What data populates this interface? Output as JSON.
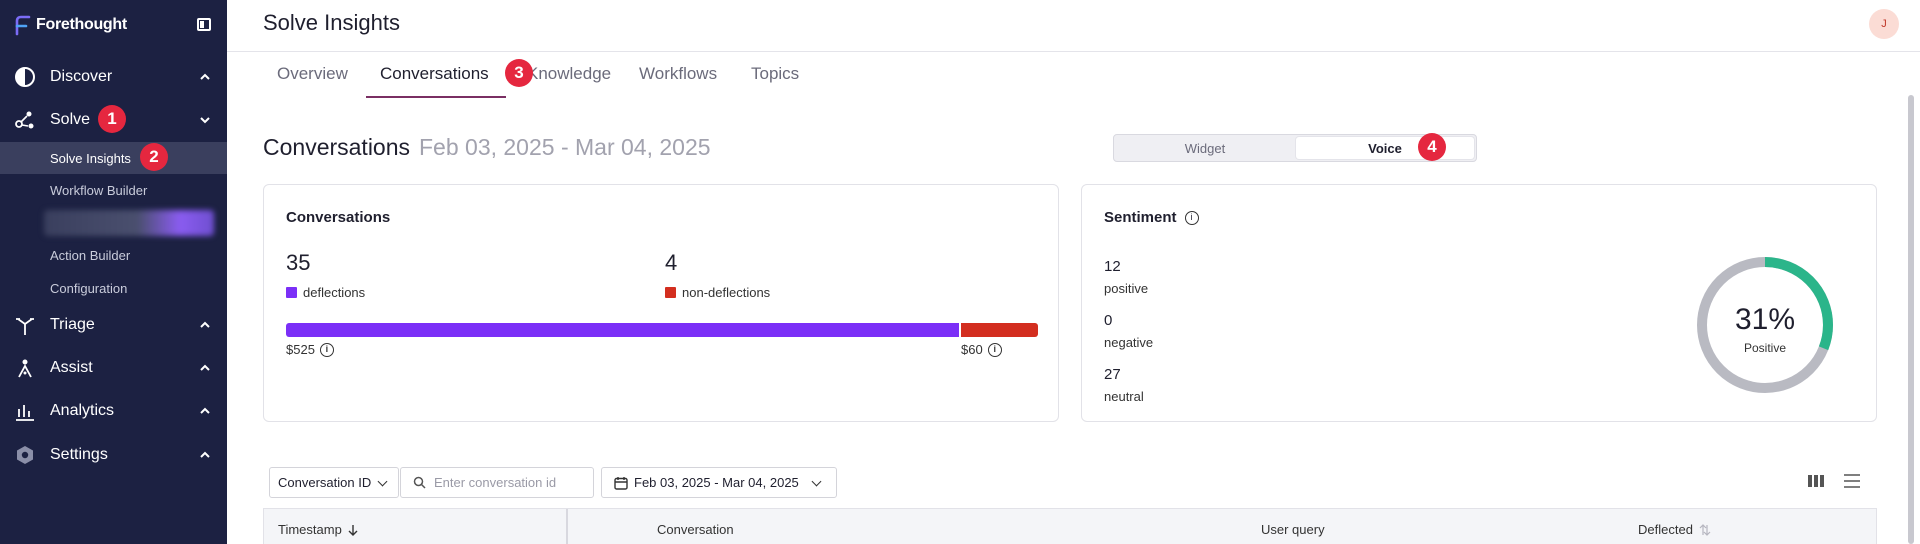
{
  "app": {
    "name": "Forethought"
  },
  "sidebar": {
    "items": [
      {
        "label": "Discover",
        "icon": "half-circle-icon"
      },
      {
        "label": "Solve",
        "icon": "nodes-icon"
      },
      {
        "label": "Triage",
        "icon": "fork-icon"
      },
      {
        "label": "Assist",
        "icon": "person-spark-icon"
      },
      {
        "label": "Analytics",
        "icon": "bar-chart-icon"
      },
      {
        "label": "Settings",
        "icon": "hexagon-gear-icon"
      }
    ],
    "solve_subitems": [
      {
        "label": "Solve Insights"
      },
      {
        "label": "Workflow Builder"
      },
      {
        "label": "Action Builder"
      },
      {
        "label": "Configuration"
      }
    ]
  },
  "badges": {
    "b1": "1",
    "b2": "2",
    "b3": "3",
    "b4": "4"
  },
  "header": {
    "title": "Solve Insights",
    "avatar_initial": "J"
  },
  "tabs": [
    {
      "label": "Overview"
    },
    {
      "label": "Conversations"
    },
    {
      "label": "Knowledge"
    },
    {
      "label": "Workflows"
    },
    {
      "label": "Topics"
    }
  ],
  "section": {
    "title": "Conversations",
    "date_range": "Feb 03, 2025 - Mar 04, 2025"
  },
  "toggle": {
    "widget": "Widget",
    "voice": "Voice",
    "selected": "Voice"
  },
  "conversations_card": {
    "title": "Conversations",
    "deflections_count": "35",
    "deflections_label": "deflections",
    "non_deflections_count": "4",
    "non_deflections_label": "non-deflections",
    "deflections_savings": "$525",
    "non_deflections_cost": "$60",
    "colors": {
      "deflections": "#7b2ff7",
      "non_deflections": "#d32e1f"
    }
  },
  "sentiment_card": {
    "title": "Sentiment",
    "positive_count": "12",
    "positive_label": "positive",
    "negative_count": "0",
    "negative_label": "negative",
    "neutral_count": "27",
    "neutral_label": "neutral",
    "percent": "31%",
    "percent_label": "Positive",
    "positive_fraction": 0.31,
    "colors": {
      "positive": "#2bb58a",
      "rest": "#b9bac2"
    }
  },
  "filters": {
    "field_select": "Conversation ID",
    "search_placeholder": "Enter conversation id",
    "date_range": "Feb 03, 2025 - Mar 04, 2025"
  },
  "table": {
    "columns": [
      "Timestamp",
      "Conversation",
      "User query",
      "Deflected"
    ]
  }
}
